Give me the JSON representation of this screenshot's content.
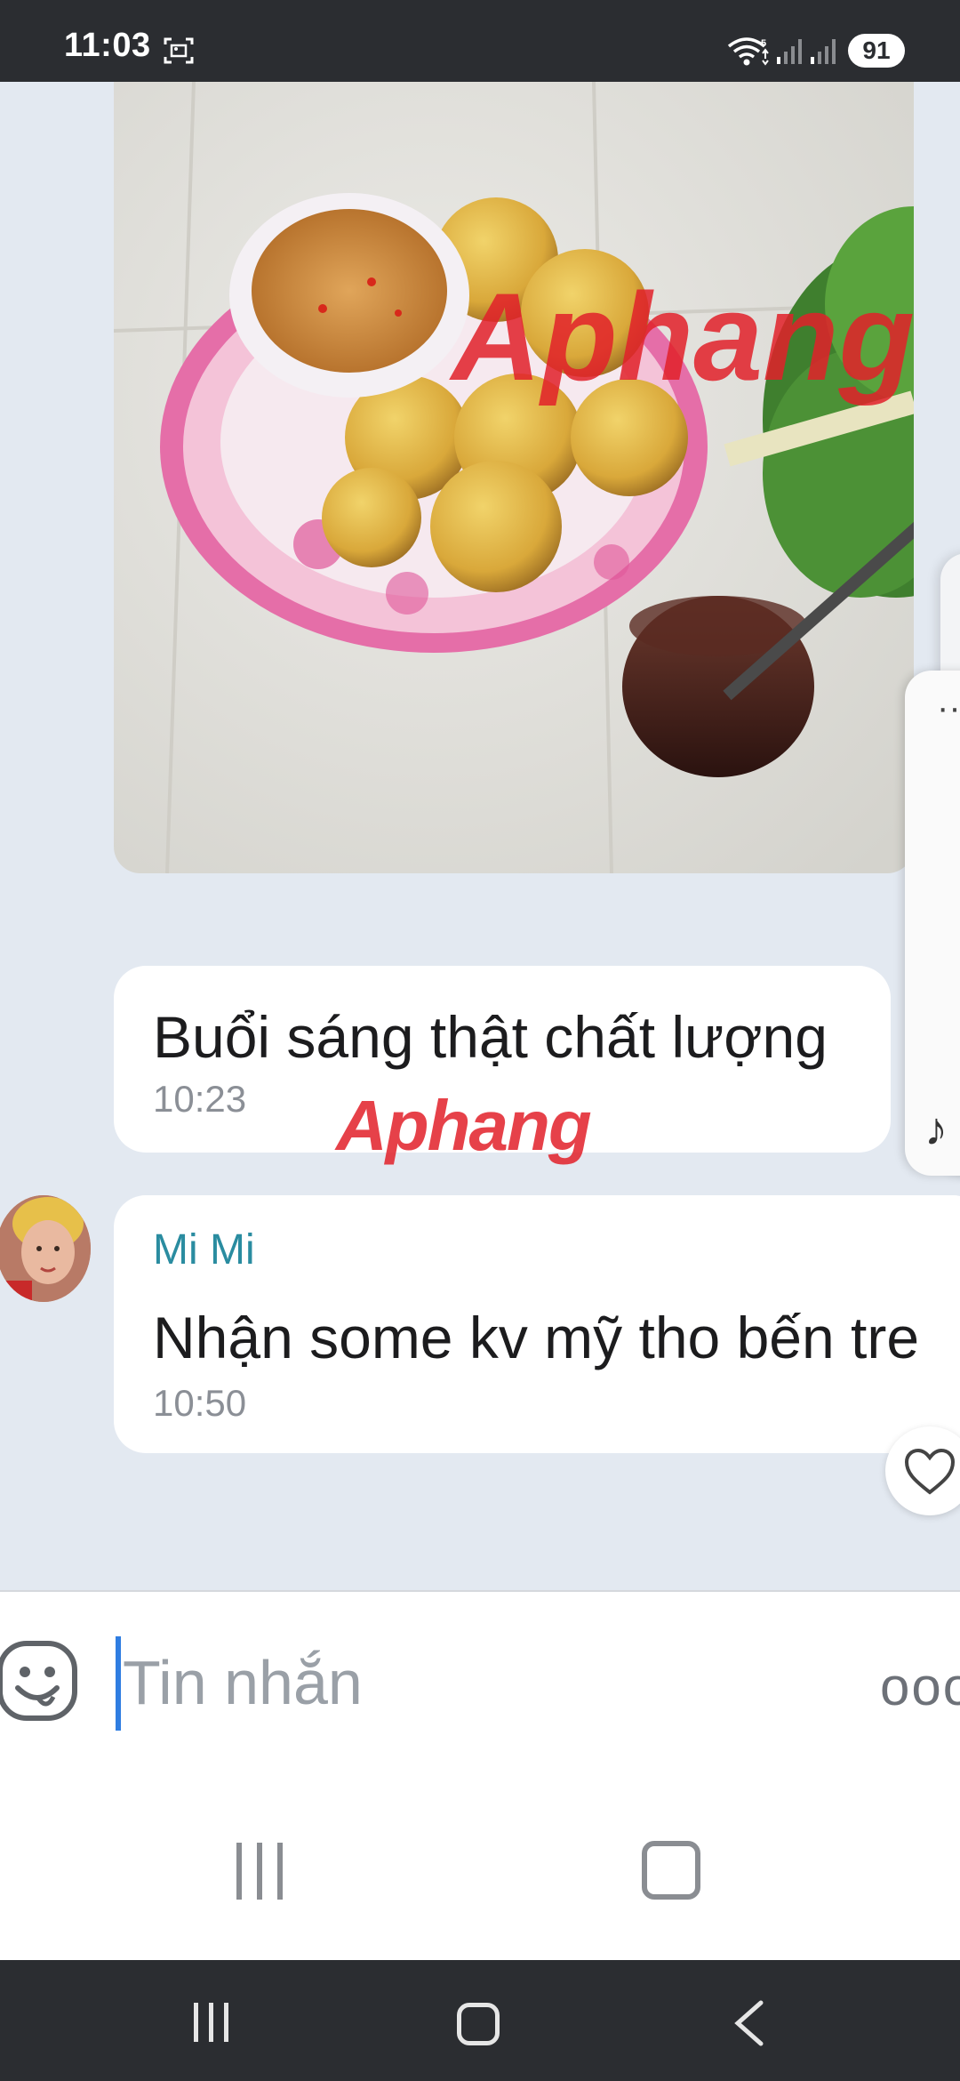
{
  "status_bar": {
    "time": "11:03",
    "battery": "91",
    "icons": [
      "screenshot-icon",
      "wifi-icon",
      "signal-icon",
      "signal-icon"
    ]
  },
  "chat": {
    "photo_message": {
      "watermark": "Aphang"
    },
    "messages": [
      {
        "text": "Buổi sáng thật chất lượng",
        "time": "10:23",
        "watermark": "Aphang"
      },
      {
        "sender": "Mi Mi",
        "text": "Nhận some kv mỹ tho bến tre",
        "time": "10:50"
      }
    ]
  },
  "input": {
    "placeholder": "Tin nhắn"
  },
  "colors": {
    "chat_background": "#e3e9f1",
    "sender_name": "#2a8ca0",
    "cursor": "#2f7de1",
    "status_bar": "#2b2d31"
  }
}
